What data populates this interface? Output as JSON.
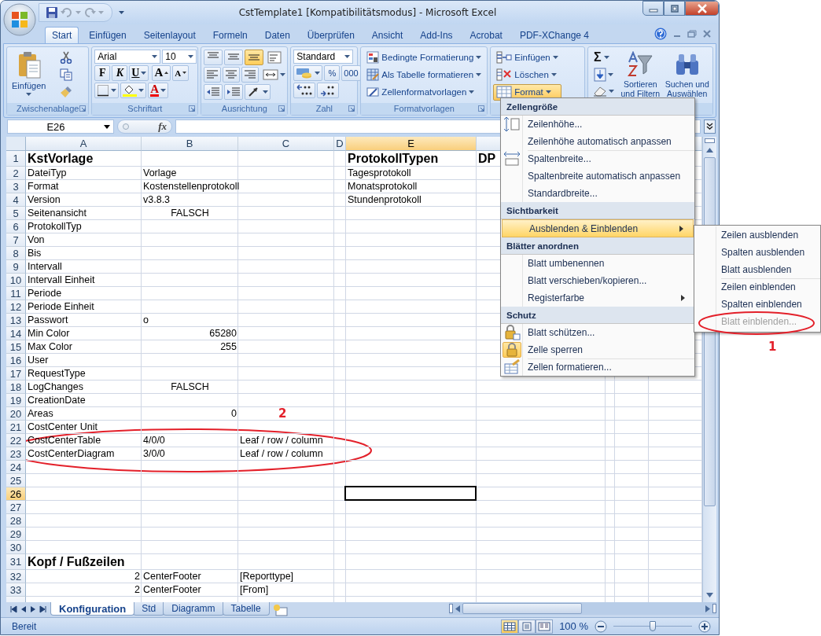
{
  "window": {
    "title": "CstTemplate1  [Kompatibilitätsmodus] - Microsoft Excel"
  },
  "ribbon_tabs": [
    {
      "label": "Start",
      "selected": true
    },
    {
      "label": "Einfügen",
      "selected": false
    },
    {
      "label": "Seitenlayout",
      "selected": false
    },
    {
      "label": "Formeln",
      "selected": false
    },
    {
      "label": "Daten",
      "selected": false
    },
    {
      "label": "Überprüfen",
      "selected": false
    },
    {
      "label": "Ansicht",
      "selected": false
    },
    {
      "label": "Add-Ins",
      "selected": false
    },
    {
      "label": "Acrobat",
      "selected": false
    },
    {
      "label": "PDF-XChange 4",
      "selected": false
    }
  ],
  "ribbon_groups": [
    {
      "kind": "clipboard",
      "title": "Zwischenablage",
      "paste_label": "Einfügen"
    },
    {
      "kind": "font",
      "title": "Schriftart",
      "font": "Arial",
      "size": "10",
      "style_buttons": [
        "F",
        "K",
        "U"
      ],
      "grow_label": "A",
      "shrink_label": "A",
      "font_color_label": "A"
    },
    {
      "kind": "alignment",
      "title": "Ausrichtung",
      "vertical_align": [
        {
          "selected": false
        },
        {
          "selected": false
        },
        {
          "selected": true
        }
      ]
    },
    {
      "kind": "number",
      "title": "Zahl",
      "format": "Standard",
      "buttons": [
        "%",
        "000"
      ]
    },
    {
      "kind": "styles",
      "title": "Formatvorlagen",
      "items": [
        "Bedingte Formatierung",
        "Als Tabelle formatieren",
        "Zellenformatvorlagen"
      ]
    },
    {
      "kind": "cells",
      "items": [
        {
          "label": "Einfügen",
          "active": false
        },
        {
          "label": "Löschen",
          "active": false
        },
        {
          "label": "Format",
          "active": true
        }
      ]
    },
    {
      "kind": "editing",
      "sum_label": "Σ",
      "sort_label": "Sortieren und Filtern",
      "find_label": "Suchen und Auswählen"
    }
  ],
  "name_box": {
    "value": "E26"
  },
  "formula_bar": {
    "function_label": "fx"
  },
  "sheet": {
    "columns": [
      {
        "label": "A",
        "selected": false
      },
      {
        "label": "B",
        "selected": false
      },
      {
        "label": "C",
        "selected": false
      },
      {
        "label": "D",
        "selected": false
      },
      {
        "label": "E",
        "selected": true
      },
      {
        "selected": false
      }
    ],
    "rows": [
      {
        "label": "1",
        "selected": false,
        "cells": [
          {
            "text": "KstVorlage",
            "kind": "heading"
          },
          null,
          null,
          null,
          {
            "text": "ProtokollTypen",
            "kind": "heading"
          },
          {
            "text": "DP",
            "kind": "heading"
          }
        ]
      },
      {
        "label": "2",
        "selected": false,
        "cells": [
          {
            "text": "DateiTyp",
            "kind": "text"
          },
          {
            "text": "Vorlage",
            "kind": "text"
          },
          null,
          null,
          {
            "text": "Tagesprotokoll",
            "kind": "text"
          }
        ]
      },
      {
        "label": "3",
        "selected": false,
        "cells": [
          {
            "text": "Format",
            "kind": "text"
          },
          {
            "text": "Kostenstellenprotokoll",
            "kind": "text"
          },
          null,
          null,
          {
            "text": "Monatsprotokoll",
            "kind": "text"
          }
        ]
      },
      {
        "label": "4",
        "selected": false,
        "cells": [
          {
            "text": "Version",
            "kind": "text"
          },
          {
            "text": "v3.8.3",
            "kind": "text"
          },
          null,
          null,
          {
            "text": "Stundenprotokoll",
            "kind": "text"
          }
        ]
      },
      {
        "label": "5",
        "selected": false,
        "cells": [
          {
            "text": "Seitenansicht",
            "kind": "text"
          },
          {
            "text": "FALSCH",
            "kind": "boolean"
          }
        ]
      },
      {
        "label": "6",
        "selected": false,
        "cells": [
          {
            "text": "ProtokollTyp",
            "kind": "text"
          }
        ]
      },
      {
        "label": "7",
        "selected": false,
        "cells": [
          {
            "text": "Von",
            "kind": "text"
          }
        ]
      },
      {
        "label": "8",
        "selected": false,
        "cells": [
          {
            "text": "Bis",
            "kind": "text"
          }
        ]
      },
      {
        "label": "9",
        "selected": false,
        "cells": [
          {
            "text": "Intervall",
            "kind": "text"
          }
        ]
      },
      {
        "label": "10",
        "selected": false,
        "cells": [
          {
            "text": "Intervall Einheit",
            "kind": "text"
          }
        ]
      },
      {
        "label": "11",
        "selected": false,
        "cells": [
          {
            "text": "Periode",
            "kind": "text"
          }
        ]
      },
      {
        "label": "12",
        "selected": false,
        "cells": [
          {
            "text": "Periode Einheit",
            "kind": "text"
          }
        ]
      },
      {
        "label": "13",
        "selected": false,
        "cells": [
          {
            "text": "Passwort",
            "kind": "text"
          },
          {
            "text": "o",
            "kind": "text"
          }
        ]
      },
      {
        "label": "14",
        "selected": false,
        "cells": [
          {
            "text": "Min Color",
            "kind": "text"
          },
          {
            "text": "65280",
            "kind": "number"
          }
        ]
      },
      {
        "label": "15",
        "selected": false,
        "cells": [
          {
            "text": "Max Color",
            "kind": "text"
          },
          {
            "text": "255",
            "kind": "number"
          }
        ]
      },
      {
        "label": "16",
        "selected": false,
        "cells": [
          {
            "text": "User",
            "kind": "text"
          }
        ]
      },
      {
        "label": "17",
        "selected": false,
        "cells": [
          {
            "text": "RequestType",
            "kind": "text"
          }
        ]
      },
      {
        "label": "18",
        "selected": false,
        "cells": [
          {
            "text": "LogChanges",
            "kind": "text"
          },
          {
            "text": "FALSCH",
            "kind": "boolean"
          }
        ]
      },
      {
        "label": "19",
        "selected": false,
        "cells": [
          {
            "text": "CreationDate",
            "kind": "text"
          }
        ]
      },
      {
        "label": "20",
        "selected": false,
        "cells": [
          {
            "text": "Areas",
            "kind": "text"
          },
          {
            "text": "0",
            "kind": "number"
          }
        ]
      },
      {
        "label": "21",
        "selected": false,
        "cells": [
          {
            "text": "CostCenter Unit",
            "kind": "text"
          }
        ]
      },
      {
        "label": "22",
        "selected": false,
        "cells": [
          {
            "text": "CostCenterTable",
            "kind": "text"
          },
          {
            "text": "4/0/0",
            "kind": "text"
          },
          {
            "text": "Leaf / row / column",
            "kind": "text"
          }
        ]
      },
      {
        "label": "23",
        "selected": false,
        "cells": [
          {
            "text": "CostCenterDiagram",
            "kind": "text"
          },
          {
            "text": "3/0/0",
            "kind": "text"
          },
          {
            "text": "Leaf / row / column",
            "kind": "text"
          }
        ]
      },
      {
        "label": "24",
        "selected": false
      },
      {
        "label": "25",
        "selected": false
      },
      {
        "label": "26",
        "selected": true
      },
      {
        "label": "27",
        "selected": false
      },
      {
        "label": "28",
        "selected": false
      },
      {
        "label": "29",
        "selected": false
      },
      {
        "label": "30",
        "selected": false
      },
      {
        "label": "31",
        "selected": false,
        "cells": [
          {
            "text": "Kopf / Fußzeilen",
            "kind": "heading"
          }
        ]
      },
      {
        "label": "32",
        "selected": false,
        "cells": [
          {
            "text": "2",
            "kind": "number"
          },
          {
            "text": "CenterFooter",
            "kind": "text"
          },
          {
            "text": "[Reporttype]",
            "kind": "text"
          }
        ]
      },
      {
        "label": "33",
        "selected": false,
        "cells": [
          {
            "text": "2",
            "kind": "number"
          },
          {
            "text": "CenterFooter",
            "kind": "text"
          },
          {
            "text": "[From]",
            "kind": "text"
          }
        ]
      }
    ]
  },
  "sheet_tabs": [
    {
      "label": "Konfiguration",
      "selected": true
    },
    {
      "label": "Std",
      "selected": false
    },
    {
      "label": "Diagramm",
      "selected": false
    },
    {
      "label": "Tabelle",
      "selected": false
    }
  ],
  "status_bar": {
    "status": "Bereit",
    "views": [
      {
        "selected": true
      },
      {
        "selected": false
      },
      {
        "selected": false
      }
    ],
    "zoom": "100 %",
    "zoom_slider": {
      "level": 0.5
    }
  },
  "format_menu": {
    "sections": [
      {
        "title": "Zellengröße",
        "items": [
          {
            "label": "Zeilenhöhe...",
            "separator": false,
            "highlighted": false,
            "submenu": false,
            "checked": false
          },
          {
            "label": "Zeilenhöhe automatisch anpassen",
            "separator": false,
            "highlighted": false,
            "submenu": false,
            "checked": false
          },
          {
            "label": "Spaltenbreite...",
            "separator": true,
            "highlighted": false,
            "submenu": false,
            "checked": false
          },
          {
            "label": "Spaltenbreite automatisch anpassen",
            "separator": false,
            "highlighted": false,
            "submenu": false,
            "checked": false
          },
          {
            "label": "Standardbreite...",
            "separator": false,
            "highlighted": false,
            "submenu": false,
            "checked": false
          }
        ]
      },
      {
        "title": "Sichtbarkeit",
        "items": [
          {
            "label": "Ausblenden & Einblenden",
            "separator": false,
            "highlighted": true,
            "submenu": true,
            "checked": false
          }
        ]
      },
      {
        "title": "Blätter anordnen",
        "items": [
          {
            "label": "Blatt umbenennen",
            "separator": false,
            "highlighted": false,
            "submenu": false,
            "checked": false
          },
          {
            "label": "Blatt verschieben/kopieren...",
            "separator": false,
            "highlighted": false,
            "submenu": false,
            "checked": false
          },
          {
            "label": "Registerfarbe",
            "separator": false,
            "highlighted": false,
            "submenu": true,
            "checked": false
          }
        ]
      },
      {
        "title": "Schutz",
        "items": [
          {
            "label": "Blatt schützen...",
            "separator": false,
            "highlighted": false,
            "submenu": false,
            "checked": false
          },
          {
            "label": "Zelle sperren",
            "separator": false,
            "highlighted": false,
            "submenu": false,
            "checked": true
          },
          {
            "label": "Zellen formatieren...",
            "separator": true,
            "highlighted": false,
            "submenu": false,
            "checked": false
          }
        ]
      }
    ]
  },
  "submenu": {
    "items": [
      {
        "label": "Zeilen ausblenden",
        "separator": false,
        "disabled": false
      },
      {
        "label": "Spalten ausblenden",
        "separator": false,
        "disabled": false
      },
      {
        "label": "Blatt ausblenden",
        "separator": false,
        "disabled": false
      },
      {
        "label": "Zeilen einblenden",
        "separator": true,
        "disabled": false
      },
      {
        "label": "Spalten einblenden",
        "separator": false,
        "disabled": false
      },
      {
        "label": "Blatt einblenden...",
        "separator": false,
        "disabled": true
      }
    ]
  },
  "annotations": [
    {
      "label": "1"
    },
    {
      "label": "2"
    }
  ]
}
